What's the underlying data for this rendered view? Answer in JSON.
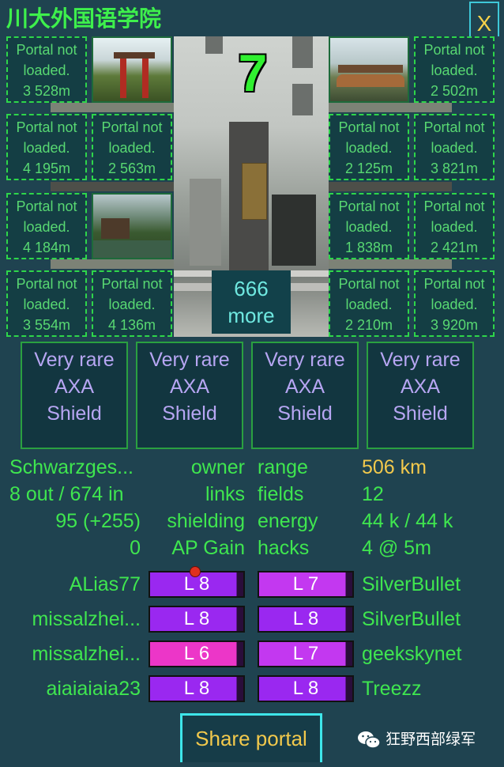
{
  "header": {
    "title": "川大外国语学院",
    "close_label": "X"
  },
  "portal": {
    "level": "7",
    "more_count": "666",
    "more_label": "more"
  },
  "linked_portals": [
    {
      "label1": "Portal not",
      "label2": "loaded.",
      "distance": "3 528m"
    },
    {
      "label1": "Portal not",
      "label2": "loaded.",
      "distance": "2 502m"
    },
    {
      "label1": "Portal not",
      "label2": "loaded.",
      "distance": "4 195m"
    },
    {
      "label1": "Portal not",
      "label2": "loaded.",
      "distance": "2 563m"
    },
    {
      "label1": "Portal not",
      "label2": "loaded.",
      "distance": "2 125m"
    },
    {
      "label1": "Portal not",
      "label2": "loaded.",
      "distance": "3 821m"
    },
    {
      "label1": "Portal not",
      "label2": "loaded.",
      "distance": "4 184m"
    },
    {
      "label1": "Portal not",
      "label2": "loaded.",
      "distance": "1 838m"
    },
    {
      "label1": "Portal not",
      "label2": "loaded.",
      "distance": "2 421m"
    },
    {
      "label1": "Portal not",
      "label2": "loaded.",
      "distance": "3 554m"
    },
    {
      "label1": "Portal not",
      "label2": "loaded.",
      "distance": "4 136m"
    },
    {
      "label1": "Portal not",
      "label2": "loaded.",
      "distance": "2 210m"
    },
    {
      "label1": "Portal not",
      "label2": "loaded.",
      "distance": "3 920m"
    }
  ],
  "mods": [
    {
      "rarity1": "Very rare",
      "name1": "AXA",
      "name2": "Shield"
    },
    {
      "rarity1": "Very rare",
      "name1": "AXA",
      "name2": "Shield"
    },
    {
      "rarity1": "Very rare",
      "name1": "AXA",
      "name2": "Shield"
    },
    {
      "rarity1": "Very rare",
      "name1": "AXA",
      "name2": "Shield"
    }
  ],
  "stats": {
    "owner_value": "Schwarzges...",
    "owner_label": "owner",
    "range_label": "range",
    "range_value": "506 km",
    "links_value": "8 out / 674 in",
    "links_label": "links",
    "fields_label": "fields",
    "fields_value": "12",
    "shielding_value": "95 (+255)",
    "shielding_label": "shielding",
    "energy_label": "energy",
    "energy_value": "44 k / 44 k",
    "ap_value": "0",
    "ap_label": "AP Gain",
    "hacks_label": "hacks",
    "hacks_value": "4 @ 5m"
  },
  "resonators": [
    {
      "left_owner": "ALias77",
      "left_level": "L 8",
      "left_color": "#9a28f0",
      "left_fill": 0.93,
      "right_level": "L 7",
      "right_color": "#c338f0",
      "right_fill": 0.93,
      "right_owner": "SilverBullet"
    },
    {
      "left_owner": "missalzhei...",
      "left_level": "L 8",
      "left_color": "#9a28f0",
      "left_fill": 0.93,
      "right_level": "L 8",
      "right_color": "#9a28f0",
      "right_fill": 0.93,
      "right_owner": "SilverBullet"
    },
    {
      "left_owner": "missalzhei...",
      "left_level": "L 6",
      "left_color": "#ec36c8",
      "left_fill": 0.93,
      "right_level": "L 7",
      "right_color": "#c338f0",
      "right_fill": 0.93,
      "right_owner": "geekskynet"
    },
    {
      "left_owner": "aiaiaiaia23",
      "left_level": "L 8",
      "left_color": "#9a28f0",
      "left_fill": 0.93,
      "right_level": "L 8",
      "right_color": "#9a28f0",
      "right_fill": 0.93,
      "right_owner": "Treezz"
    }
  ],
  "share_label": "Share portal",
  "watermark": "狂野西部绿军"
}
